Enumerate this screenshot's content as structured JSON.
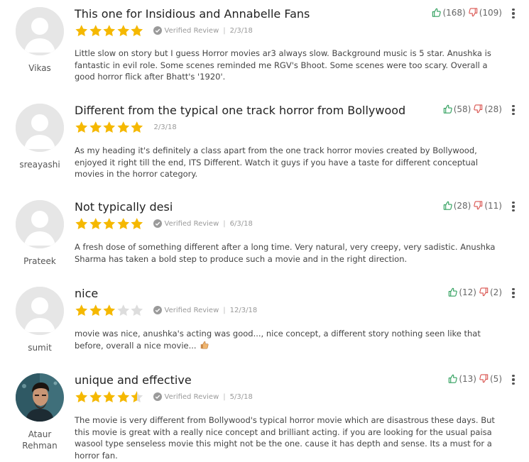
{
  "colors": {
    "star": "#f5b800",
    "star_empty": "#dddddd",
    "like": "#2e9f5c",
    "dislike": "#d9534f"
  },
  "icons": {
    "like": "thumbs-up-icon",
    "dislike": "thumbs-down-icon",
    "verified": "check-circle-icon",
    "menu": "more-vertical-icon",
    "emoji": "thumbs-up-emoji"
  },
  "reviews": [
    {
      "author": "Vikas",
      "title": "This one for Insidious and Annabelle Fans",
      "rating": 5,
      "verified_label": "Verified Review",
      "date": "2/3/18",
      "body": "Little slow on story but I guess Horror movies ar3 always slow. Background music is 5 star. Anushka is fantastic in evil role. Some scenes reminded me RGV's Bhoot. Some scenes were too scary. Overall a good horror flick after Bhatt's '1920'.",
      "likes": "(168)",
      "dislikes": "(109)"
    },
    {
      "author": "sreayashi",
      "title": "Different from the typical one track horror from Bollywood",
      "rating": 5,
      "date": "2/3/18",
      "body": "As my heading it's definitely a class apart from the one track horror movies created by Bollywood, enjoyed it right till the end, ITS Different. Watch it guys if you have a taste for different conceptual movies in the horror category.",
      "likes": "(58)",
      "dislikes": "(28)"
    },
    {
      "author": "Prateek",
      "title": "Not typically desi",
      "rating": 5,
      "verified_label": "Verified Review",
      "date": "6/3/18",
      "body": "A fresh dose of something different after a long time. Very natural, very creepy, very sadistic. Anushka Sharma has taken a bold step to produce such a movie and in the right direction.",
      "likes": "(28)",
      "dislikes": "(11)"
    },
    {
      "author": "sumit",
      "title": "nice",
      "rating": 3,
      "verified_label": "Verified Review",
      "date": "12/3/18",
      "body": "movie was nice, anushka's acting was good..., nice concept, a different story nothing seen like that before, overall a nice movie...",
      "likes": "(12)",
      "dislikes": "(2)"
    },
    {
      "author": "Ataur Rehman",
      "title": "unique and effective",
      "rating": 4.5,
      "verified_label": "Verified Review",
      "date": "5/3/18",
      "body": "The movie is very different from Bollywood's typical horror movie which are disastrous these days. But this movie is great with a really nice concept and brilliant acting. if you are looking for the usual paisa wasool type senseless movie this might not be the one. cause it has depth and sense. Its a must for a horror fan.",
      "likes": "(13)",
      "dislikes": "(5)"
    }
  ]
}
